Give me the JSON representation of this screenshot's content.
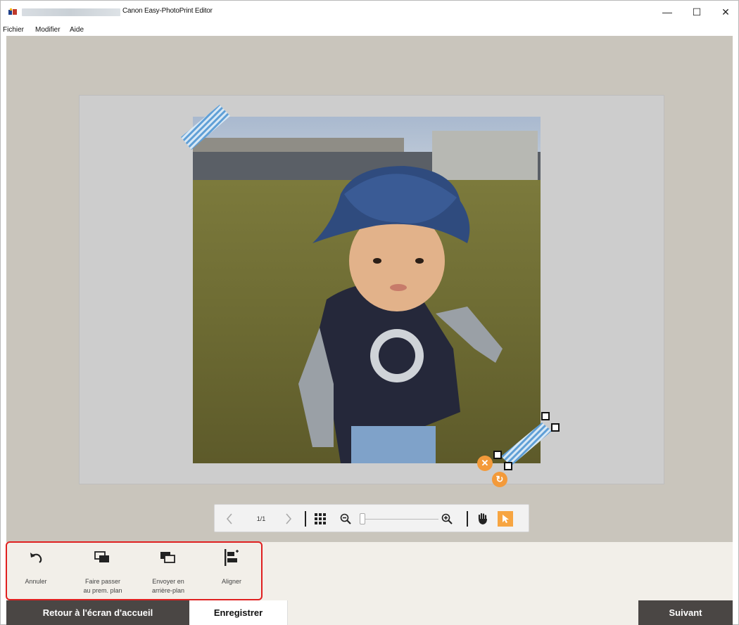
{
  "window": {
    "title": "Canon Easy-PhotoPrint Editor",
    "minimize_glyph": "—",
    "maximize_glyph": "☐",
    "close_glyph": "✕"
  },
  "menu": {
    "items": [
      {
        "label": "Fichier"
      },
      {
        "label": "Modifier"
      },
      {
        "label": "Aide"
      }
    ]
  },
  "canvas": {
    "photo_description_icon": "photo-child-with-hat-icon",
    "delete_glyph": "✕",
    "rotate_glyph": "↻"
  },
  "view_toolbar": {
    "page_indicator": "1/1",
    "zoom_level": 0,
    "active_tool": "pointer"
  },
  "edit_toolbar": {
    "buttons": [
      {
        "label_line1": "Annuler",
        "label_line2": "",
        "icon": "undo-icon"
      },
      {
        "label_line1": "Faire passer",
        "label_line2": "au prem. plan",
        "icon": "bring-to-front-icon"
      },
      {
        "label_line1": "Envoyer en",
        "label_line2": "arrière-plan",
        "icon": "send-to-back-icon"
      },
      {
        "label_line1": "Aligner",
        "label_line2": "",
        "icon": "align-icon"
      }
    ]
  },
  "bottom_bar": {
    "home_label": "Retour à l'écran d'accueil",
    "save_label": "Enregistrer",
    "next_label": "Suivant"
  },
  "colors": {
    "accent": "#f7a541",
    "workspace": "#c9c5bc",
    "dark_button": "#4a4644",
    "highlight_outline": "#e02020"
  }
}
